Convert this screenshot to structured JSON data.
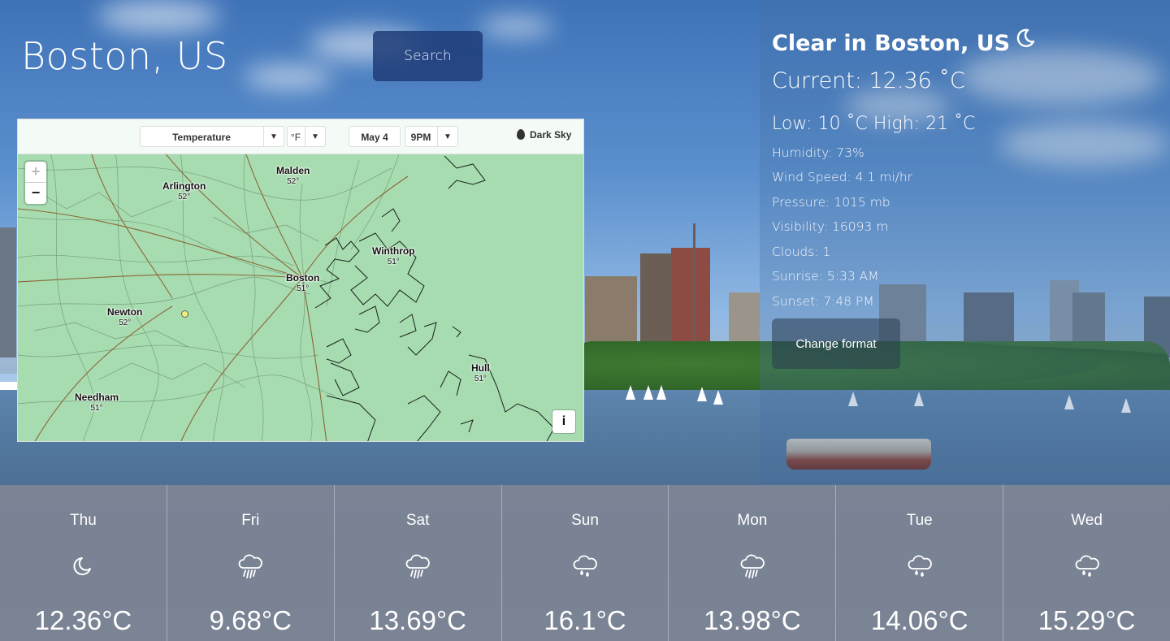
{
  "header": {
    "city": "Boston, US",
    "search_label": "Search"
  },
  "map": {
    "layer_select": "Temperature",
    "unit_select": "°F",
    "date_select": "May 4",
    "time_select": "9PM",
    "brand": "Dark Sky",
    "zoom_in": "+",
    "zoom_out": "−",
    "info": "i",
    "places": [
      {
        "name": "Arlington",
        "temp": "52°"
      },
      {
        "name": "Malden",
        "temp": "52°"
      },
      {
        "name": "Winthrop",
        "temp": "51°"
      },
      {
        "name": "Boston",
        "temp": "51°"
      },
      {
        "name": "Newton",
        "temp": "52°"
      },
      {
        "name": "Hull",
        "temp": "51°"
      },
      {
        "name": "Needham",
        "temp": "51°"
      }
    ]
  },
  "weather": {
    "condition": "Clear in Boston, US",
    "condition_icon": "moon-icon",
    "current": "Current: 12.36 ˚C",
    "low_high": "Low: 10 ˚C High: 21 ˚C",
    "stats": [
      "Humidity: 73%",
      "Wind Speed: 4.1 mi/hr",
      "Pressure: 1015 mb",
      "Visibility: 16093 m",
      "Clouds: 1",
      "Sunrise: 5:33 AM",
      "Sunset: 7:48 PM"
    ],
    "format_label": "Change format"
  },
  "forecast": [
    {
      "day": "Thu",
      "temp": "12.36°C",
      "icon": "moon-icon"
    },
    {
      "day": "Fri",
      "temp": "9.68°C",
      "icon": "rain-cloud-icon"
    },
    {
      "day": "Sat",
      "temp": "13.69°C",
      "icon": "rain-cloud-icon"
    },
    {
      "day": "Sun",
      "temp": "16.1°C",
      "icon": "showers-cloud-icon"
    },
    {
      "day": "Mon",
      "temp": "13.98°C",
      "icon": "rain-cloud-icon"
    },
    {
      "day": "Tue",
      "temp": "14.06°C",
      "icon": "showers-cloud-icon"
    },
    {
      "day": "Wed",
      "temp": "15.29°C",
      "icon": "showers-cloud-icon"
    }
  ]
}
